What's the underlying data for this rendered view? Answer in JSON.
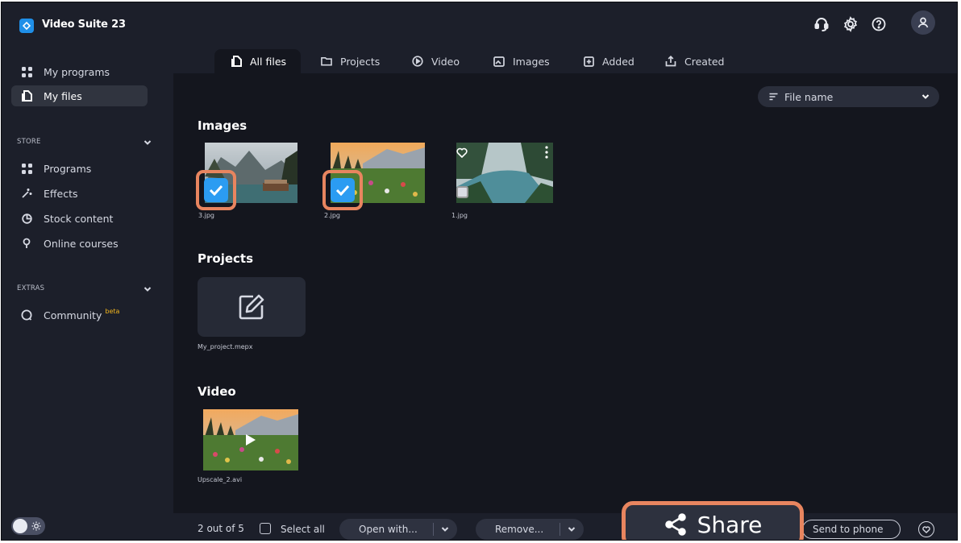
{
  "app": {
    "title": "Video Suite 23",
    "icons": [
      "support-icon",
      "settings-icon",
      "help-icon",
      "account-icon"
    ]
  },
  "sidebar": {
    "items": [
      {
        "label": "My programs",
        "icon": "grid-icon",
        "active": false
      },
      {
        "label": "My files",
        "icon": "file-icon",
        "active": true
      }
    ],
    "store": {
      "title": "STORE",
      "items": [
        {
          "label": "Programs",
          "icon": "grid-icon"
        },
        {
          "label": "Effects",
          "icon": "magic-wand-icon"
        },
        {
          "label": "Stock content",
          "icon": "pie-chart-icon"
        },
        {
          "label": "Online courses",
          "icon": "location-pin-icon"
        }
      ]
    },
    "extras": {
      "title": "EXTRAS",
      "items": [
        {
          "label": "Community",
          "badge": "beta",
          "icon": "chat-bubble-icon"
        }
      ]
    }
  },
  "tabs": [
    {
      "label": "All files",
      "icon": "file-icon",
      "active": true
    },
    {
      "label": "Projects",
      "icon": "folder-icon"
    },
    {
      "label": "Video",
      "icon": "play-circle-icon"
    },
    {
      "label": "Images",
      "icon": "image-icon"
    },
    {
      "label": "Added",
      "icon": "plus-square-icon"
    },
    {
      "label": "Created",
      "icon": "upload-icon"
    }
  ],
  "sort": {
    "label": "File name"
  },
  "sections": {
    "images": {
      "title": "Images",
      "files": [
        {
          "name": "3.jpg",
          "checked": true
        },
        {
          "name": "2.jpg",
          "checked": true
        },
        {
          "name": "1.jpg",
          "checked": false
        }
      ]
    },
    "projects": {
      "title": "Projects",
      "files": [
        {
          "name": "My_project.mepx"
        }
      ]
    },
    "video": {
      "title": "Video",
      "files": [
        {
          "name": "Upscale_2.avi"
        }
      ]
    }
  },
  "bottom": {
    "selected_count": "2 out of 5",
    "select_all": "Select all",
    "open_with": "Open with...",
    "remove": "Remove...",
    "share": "Share",
    "send_to_phone": "Send to phone"
  },
  "colors": {
    "accent": "#2b9cf2",
    "highlight": "#e8855f",
    "background": "#1c1f2a",
    "content_bg": "#14161e"
  }
}
